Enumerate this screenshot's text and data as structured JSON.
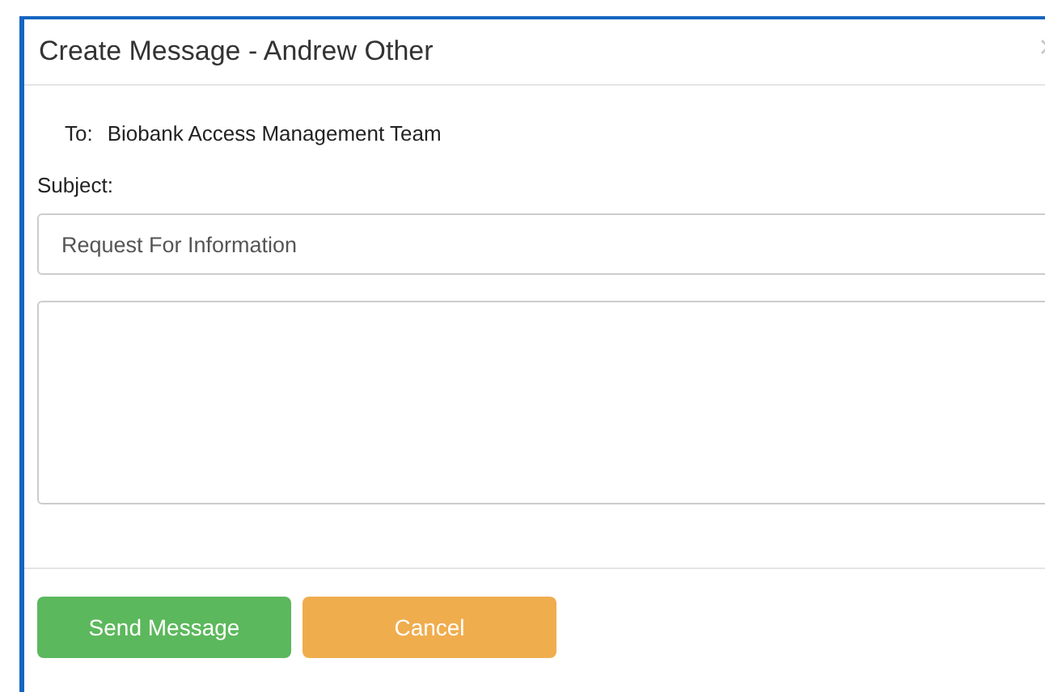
{
  "dialog": {
    "title": "Create Message - Andrew Other",
    "to_label": "To:",
    "to_value": "Biobank Access Management Team",
    "subject_label": "Subject:",
    "subject_value": "Request For Information",
    "buttons": [
      {
        "label": "Send Message",
        "kind": "primary"
      },
      {
        "label": "Cancel",
        "kind": "warning"
      }
    ]
  }
}
